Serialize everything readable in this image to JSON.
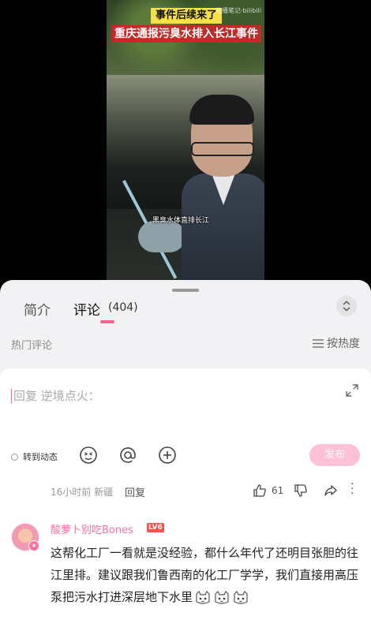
{
  "video": {
    "title_badge": "事件后续来了",
    "title_main": "重庆通报污臭水排入长江事件",
    "watermark": "吃播笔记·bilibili",
    "caption": "黑臭水体直排长江"
  },
  "tabs": {
    "intro": "简介",
    "comments": "评论",
    "comment_count": "(404)"
  },
  "section": {
    "hot_label": "热门评论",
    "sort_label": "按热度"
  },
  "composer": {
    "placeholder": "回复 逆境点火：",
    "forward_label": "转到动态",
    "publish_label": "发布"
  },
  "prev_comment_meta": {
    "time_location": "16小时前 新疆",
    "reply_label": "回复",
    "like_count": "61"
  },
  "comment": {
    "username": "酸萝卜别吃Bones",
    "level": "LV6",
    "text": "这帮化工厂一看就是没经验，都什么年代了还明目张胆的往江里排。建议跟我们鲁西南的化工厂学学，我们直接用高压泵把污水打进深层地下水里"
  },
  "colors": {
    "accent_pink": "#ff5f8e",
    "publish_disabled": "#ffc2d4",
    "level_red": "#ff4d4d"
  }
}
